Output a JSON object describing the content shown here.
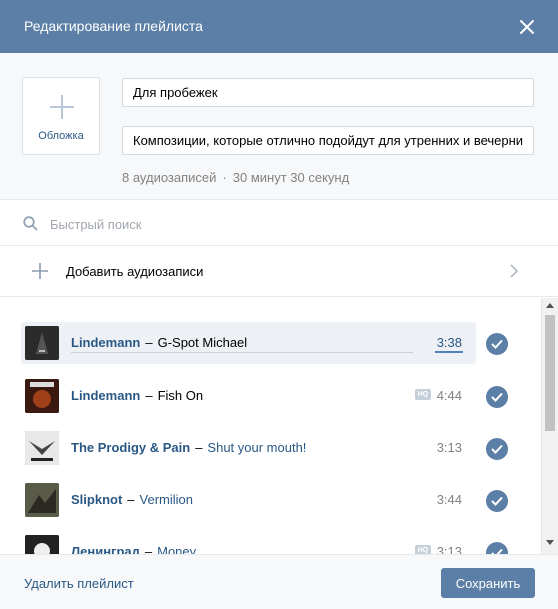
{
  "header": {
    "title": "Редактирование плейлиста",
    "close_icon": "close-icon"
  },
  "cover": {
    "label": "Обложка",
    "icon": "plus-icon"
  },
  "form": {
    "title_value": "Для пробежек",
    "description_value": "Композиции, которые отлично подойдут для утренних и вечерних пробежек"
  },
  "stats": {
    "count": "8 аудиозаписей",
    "separator": "·",
    "duration": "30 минут 30 секунд"
  },
  "search": {
    "placeholder": "Быстрый поиск",
    "icon": "search-icon"
  },
  "add_audio": {
    "label": "Добавить аудиозаписи",
    "icon": "plus-icon",
    "chevron": "chevron-right-icon"
  },
  "tracks": [
    {
      "artist": "Lindemann",
      "dash": "–",
      "title": "G-Spot Michael",
      "duration": "3:38",
      "hq": false,
      "active": true,
      "progress": 0.0,
      "title_link": false,
      "cover_color": "#2b2b2b"
    },
    {
      "artist": "Lindemann",
      "dash": "–",
      "title": "Fish On",
      "duration": "4:44",
      "hq": true,
      "hq_label": "HQ",
      "active": false,
      "title_link": false,
      "cover_color": "#6a2a1a"
    },
    {
      "artist": "The Prodigy & Pain",
      "dash": "–",
      "title": "Shut your mouth!",
      "duration": "3:13",
      "hq": false,
      "active": false,
      "title_link": true,
      "cover_color": "#3a3a3a"
    },
    {
      "artist": "Slipknot",
      "dash": "–",
      "title": "Vermilion",
      "duration": "3:44",
      "hq": false,
      "active": false,
      "title_link": true,
      "cover_color": "#4a4a3a"
    },
    {
      "artist": "Ленинград",
      "dash": "–",
      "title": "Money",
      "duration": "3:13",
      "hq": true,
      "hq_label": "HQ",
      "active": false,
      "title_link": true,
      "cover_color": "#222222"
    }
  ],
  "footer": {
    "delete_label": "Удалить плейлист",
    "save_label": "Сохранить"
  },
  "colors": {
    "header_bg": "#5b7fa6",
    "link": "#2a5885",
    "check_bg": "#5b7fa6",
    "muted": "#828282"
  }
}
